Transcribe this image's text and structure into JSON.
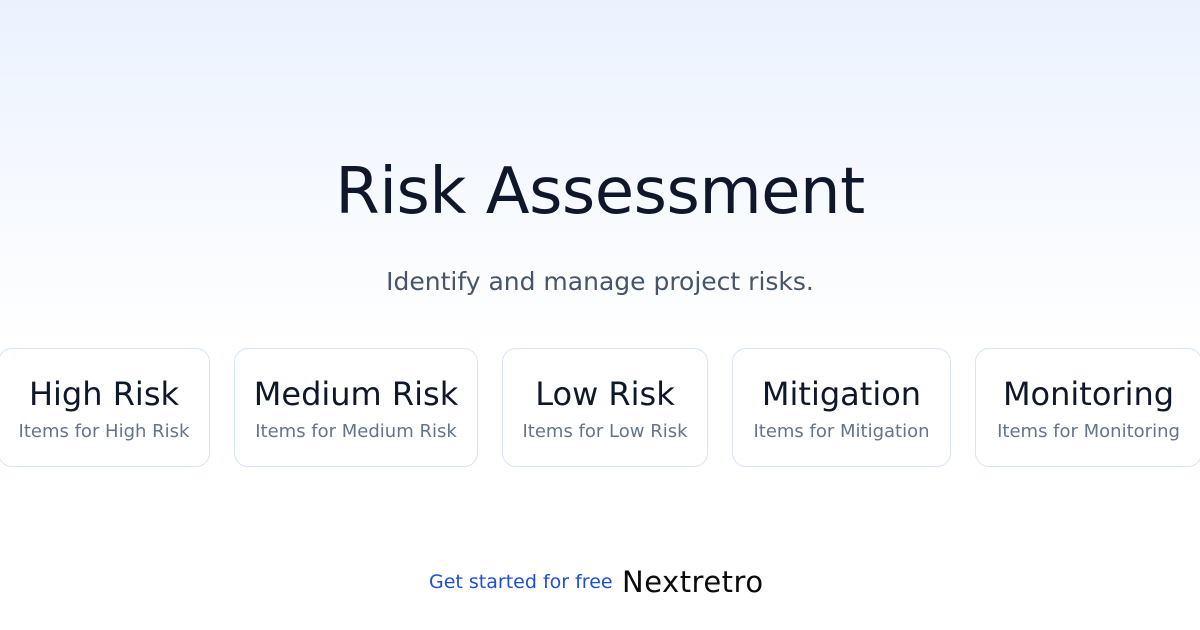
{
  "hero": {
    "title": "Risk Assessment",
    "subtitle": "Identify and manage project risks."
  },
  "cards": [
    {
      "title": "High Risk",
      "description": "Items for High Risk"
    },
    {
      "title": "Medium Risk",
      "description": "Items for Medium Risk"
    },
    {
      "title": "Low Risk",
      "description": "Items for Low Risk"
    },
    {
      "title": "Mitigation",
      "description": "Items for Mitigation"
    },
    {
      "title": "Monitoring",
      "description": "Items for Monitoring"
    }
  ],
  "footer": {
    "cta_label": "Get started for free",
    "brand_name": "Nextretro"
  },
  "colors": {
    "accent": "#1d4ed8",
    "heading": "#0f172a",
    "muted": "#64748b",
    "card_border": "#d5e3fb"
  }
}
